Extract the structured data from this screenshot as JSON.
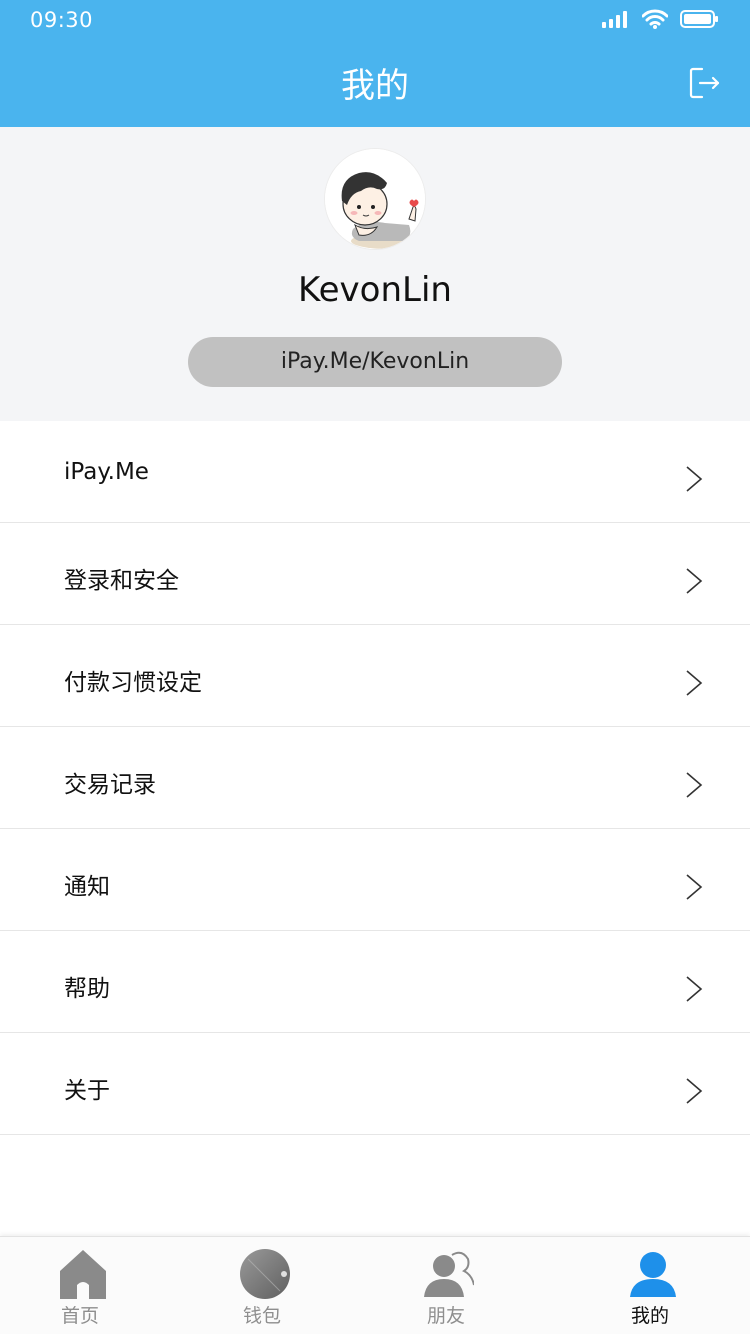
{
  "status_bar": {
    "time": "09:30"
  },
  "nav": {
    "title": "我的"
  },
  "profile": {
    "username": "KevonLin",
    "link": "iPay.Me/KevonLin"
  },
  "menu": {
    "items": [
      {
        "label": "iPay.Me"
      },
      {
        "label": "登录和安全"
      },
      {
        "label": "付款习惯设定"
      },
      {
        "label": "交易记录"
      },
      {
        "label": "通知"
      },
      {
        "label": "帮助"
      },
      {
        "label": "关于"
      }
    ]
  },
  "tabbar": {
    "tabs": [
      {
        "label": "首页",
        "icon": "home-icon"
      },
      {
        "label": "钱包",
        "icon": "wallet-icon"
      },
      {
        "label": "朋友",
        "icon": "friends-icon"
      },
      {
        "label": "我的",
        "icon": "profile-icon"
      }
    ],
    "active_index": 3
  },
  "colors": {
    "header": "#4ab4ee",
    "active_tab": "#1e90ea",
    "inactive_tab": "#8e8e8e",
    "profile_bg": "#f4f5f7",
    "link_pill": "#c1c1c1"
  }
}
